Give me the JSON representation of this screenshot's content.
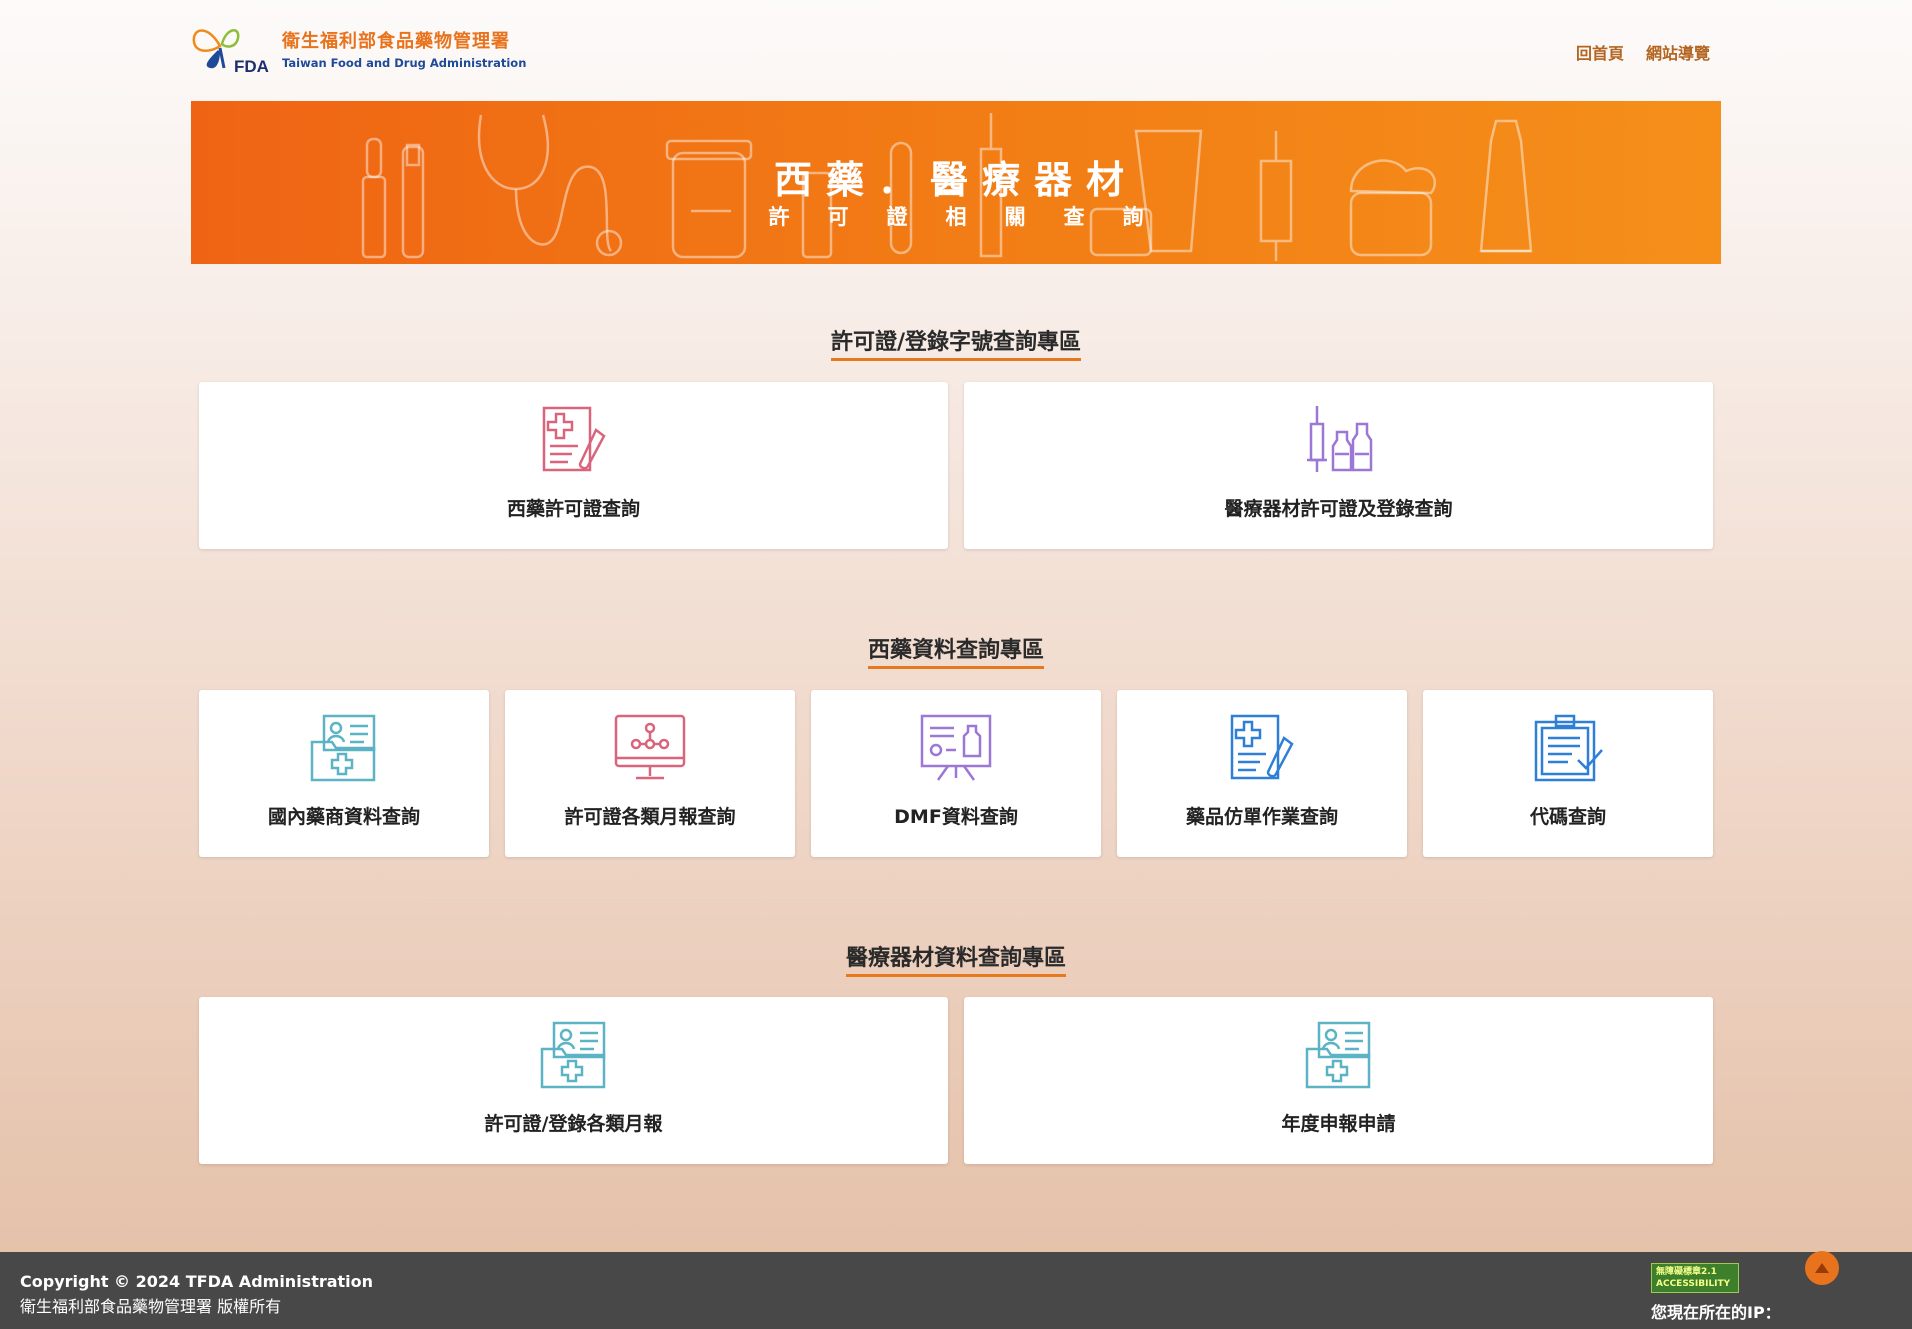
{
  "header": {
    "logo_mark": "FDA",
    "logo_cn": "衛生福利部食品藥物管理署",
    "logo_en": "Taiwan Food and Drug Administration",
    "nav": [
      {
        "label": "回首頁"
      },
      {
        "label": "網站導覽"
      }
    ]
  },
  "banner": {
    "title": "西藥．醫療器材",
    "subtitle": "許可證相關查詢"
  },
  "sections": [
    {
      "title": "許可證/登錄字號查詢專區",
      "cards": [
        {
          "label": "西藥許可證查詢",
          "icon": "document-testtube-icon"
        },
        {
          "label": "醫療器材許可證及登錄查詢",
          "icon": "syringe-vials-icon"
        }
      ]
    },
    {
      "title": "西藥資料查詢專區",
      "cards": [
        {
          "label": "國內藥商資料查詢",
          "icon": "medical-folder-icon"
        },
        {
          "label": "許可證各類月報查詢",
          "icon": "monitor-molecule-icon"
        },
        {
          "label": "DMF資料查詢",
          "icon": "presentation-board-icon"
        },
        {
          "label": "藥品仿單作業查詢",
          "icon": "document-testtube-icon"
        },
        {
          "label": "代碼查詢",
          "icon": "clipboard-check-icon"
        }
      ]
    },
    {
      "title": "醫療器材資料查詢專區",
      "cards": [
        {
          "label": "許可證/登錄各類月報",
          "icon": "medical-folder-icon"
        },
        {
          "label": "年度申報申請",
          "icon": "medical-folder-icon"
        }
      ]
    }
  ],
  "colors": {
    "accent": "#e8731c",
    "pink": "#d9657c",
    "purple": "#9b77d6",
    "teal": "#5bb3c4",
    "blue": "#2f7fd6",
    "footer": "#484848"
  },
  "footer": {
    "copyright": "Copyright © 2024 TFDA Administration",
    "rights": "衛生福利部食品藥物管理署 版權所有",
    "badge_cn": "無障礙標章2.1",
    "badge_en": "ACCESSIBILITY",
    "ip_label": "您現在所在的IP："
  }
}
